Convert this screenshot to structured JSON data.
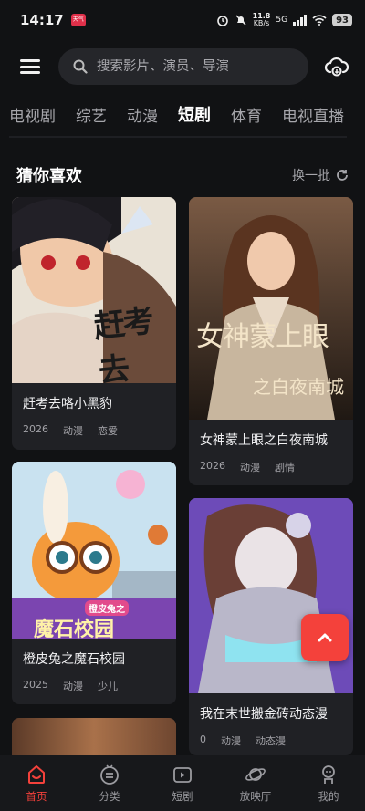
{
  "status_bar": {
    "time": "14:17",
    "badge": "天气",
    "net_speed": "11.8",
    "net_unit": "KB/s",
    "network": "5G",
    "battery": "93"
  },
  "header": {
    "search_placeholder": "搜索影片、演员、导演"
  },
  "tabs": [
    "电视剧",
    "综艺",
    "动漫",
    "短剧",
    "体育",
    "电视直播"
  ],
  "active_tab": 3,
  "section": {
    "title": "猜你喜欢",
    "refresh_label": "换一批"
  },
  "cards": [
    {
      "title": "赶考去咯小黑豹",
      "year": "2026",
      "genre": "动漫",
      "tag": "恋爱",
      "poster_text": "赶考去"
    },
    {
      "title": "女神蒙上眼之白夜南城",
      "year": "2026",
      "genre": "动漫",
      "tag": "剧情",
      "poster_text": "女神蒙上眼",
      "poster_sub": "之白夜南城"
    },
    {
      "title": "橙皮兔之魔石校园",
      "year": "2025",
      "genre": "动漫",
      "tag": "少儿",
      "poster_text": "魔石校园",
      "poster_sub": "橙皮兔之"
    },
    {
      "title": "我在末世搬金砖动态漫",
      "year": "0",
      "genre": "动漫",
      "tag": "动态漫"
    }
  ],
  "bottom_nav": [
    {
      "label": "首页",
      "icon": "home-icon"
    },
    {
      "label": "分类",
      "icon": "category-icon"
    },
    {
      "label": "短剧",
      "icon": "short-drama-icon"
    },
    {
      "label": "放映厅",
      "icon": "planet-icon"
    },
    {
      "label": "我的",
      "icon": "profile-icon"
    }
  ],
  "colors": {
    "accent": "#f4413b",
    "background": "#111214",
    "card": "#202125"
  }
}
